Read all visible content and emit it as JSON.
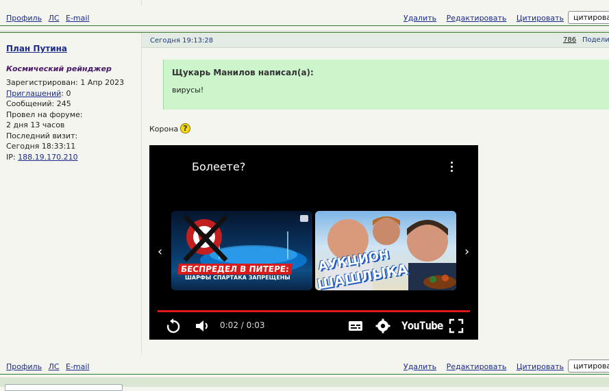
{
  "actions": {
    "profile": "Профиль",
    "pm": "ЛС",
    "email": "E-mail",
    "delete": "Удалить",
    "edit": "Редактировать",
    "quote": "Цитировать",
    "quote_button": "цитирова"
  },
  "user": {
    "name": "План Путина",
    "title": "Космический рейнджер",
    "registered": "Зарегистрирован: 1 Апр 2023",
    "invites_label": "Приглашений",
    "invites_value": ": 0",
    "posts": "Сообщений: 245",
    "time_on_forum_label": "Провел на форуме:",
    "time_on_forum_value": "2 дня 13 часов",
    "last_visit_label": "Последний визит:",
    "last_visit_value": "Сегодня 18:33:11",
    "ip_label": "IP: ",
    "ip_value": "188.19.170.210"
  },
  "post": {
    "date": "Сегодня 19:13:28",
    "number": "786",
    "share": "Поделиться",
    "quote_author": "Щукарь Манилов написал(а):",
    "quote_text": "вирусы!",
    "text": "Корона",
    "help_icon_glyph": "?"
  },
  "video": {
    "title": "Болеете?",
    "thumb1_caption": "БЕСПРЕДЕЛ В ПИТЕРЕ:",
    "thumb1_sub": "ШАРФЫ СПАРТАКА ЗАПРЕЩЕНЫ",
    "thumb2_caption_1": "АУКЦИОН",
    "thumb2_caption_2": "ШАШЛЫКА",
    "time": "0:02 / 0:03",
    "logo": "YouTube",
    "progress": 1.0,
    "icons": [
      "replay-icon",
      "volume-icon",
      "subtitles-icon",
      "settings-icon",
      "fullscreen-icon"
    ],
    "colors": {
      "progress": "#e01818",
      "background": "#000000"
    }
  },
  "colors": {
    "link": "#1a2a8c",
    "accent_line": "#2f7a2f",
    "quote_bg": "#ccf5cc",
    "user_title": "#4a1a6a"
  }
}
